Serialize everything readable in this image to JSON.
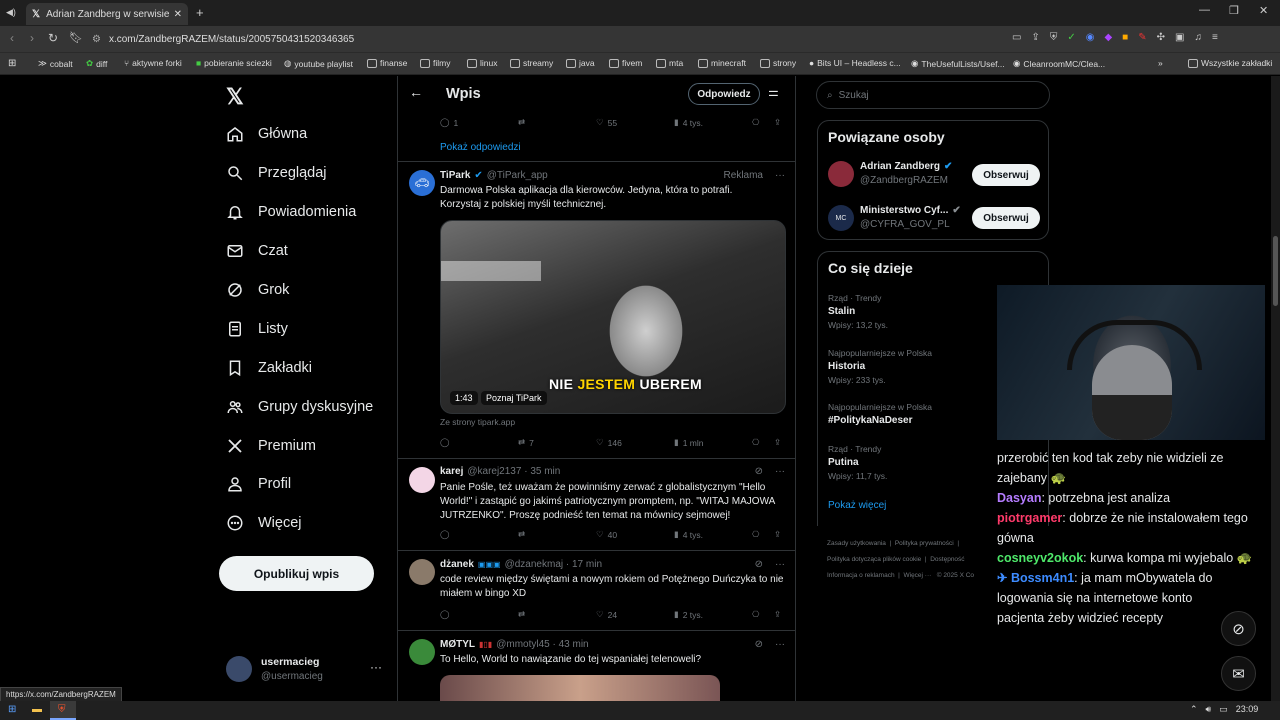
{
  "browser": {
    "tab_title": "Adrian Zandberg w serwisie X: „",
    "url": "x.com/ZandbergRAZEM/status/2005750431520346365",
    "status_url": "https://x.com/ZandbergRAZEM",
    "bookmarks": [
      "cobalt",
      "diff",
      "aktywne forki",
      "pobieranie sciezki",
      "youtube playlist",
      "finanse",
      "filmy",
      "linux",
      "streamy",
      "java",
      "fivem",
      "mta",
      "minecraft",
      "strony",
      "Bits UI – Headless c...",
      "TheUsefulLists/Usef...",
      "CleanroomMC/Clea...",
      "Wszystkie zakładki"
    ]
  },
  "nav": {
    "items": [
      "Główna",
      "Przeglądaj",
      "Powiadomienia",
      "Czat",
      "Grok",
      "Listy",
      "Zakładki",
      "Grupy dyskusyjne",
      "Premium",
      "Profil",
      "Więcej"
    ],
    "post_button": "Opublikuj wpis",
    "user_name": "usermacieg",
    "user_handle": "@usermacieg"
  },
  "feed": {
    "header_title": "Wpis",
    "reply_button": "Odpowiedz",
    "top_stats": {
      "replies": "1",
      "likes": "55",
      "views": "4 tys."
    },
    "show_replies": "Pokaż odpowiedzi",
    "ad": {
      "name": "TiPark",
      "handle": "@TiPark_app",
      "label": "Reklama",
      "text": "Darmowa Polska aplikacja dla kierowców. Jedyna, która to potrafi. Korzystaj z polskiej myśli technicznej.",
      "video_caption_a": "NIE ",
      "video_caption_b": "JESTEM",
      "video_caption_c": " UBEREM",
      "duration": "1:43",
      "video_link": "Poznaj TiPark",
      "source": "Ze strony tipark.app",
      "reposts": "7",
      "likes": "146",
      "views": "1 mln"
    },
    "posts": [
      {
        "name": "karej",
        "handle": "@karej2137 · 35 min",
        "text": "Panie Pośle, też uważam że powinniśmy zerwać z globalistycznym \"Hello World!\" i zastąpić go jakimś patriotycznym promptem, np. \"WITAJ MAJOWA JUTRZENKO\". Proszę podnieść ten temat na mównicy sejmowej!",
        "replies": "",
        "reposts": "",
        "likes": "40",
        "views": "4 tys."
      },
      {
        "name": "dżanek",
        "handle": "@dzanekmaj · 17 min",
        "text": "code review między świętami a nowym rokiem od Potężnego Duńczyka to nie miałem w bingo XD",
        "replies": "",
        "reposts": "",
        "likes": "24",
        "views": "2 tys."
      },
      {
        "name": "MØTYL",
        "handle": "@mmotyl45 · 43 min",
        "text": "To Hello, World to nawiązanie do tej wspaniałej telenoweli?"
      }
    ]
  },
  "right": {
    "search_placeholder": "Szukaj",
    "related_title": "Powiązane osoby",
    "related": [
      {
        "name": "Adrian Zandberg",
        "handle": "@ZandbergRAZEM",
        "button": "Obserwuj"
      },
      {
        "name": "Ministerstwo Cyf...",
        "handle": "@CYFRA_GOV_PL",
        "button": "Obserwuj"
      }
    ],
    "trends_title": "Co się dzieje",
    "trends": [
      {
        "cat": "Rząd · Trendy",
        "name": "Stalin",
        "count": "Wpisy: 13,2 tys."
      },
      {
        "cat": "Najpopularniejsze w Polska",
        "name": "Historia",
        "count": "Wpisy: 233 tys."
      },
      {
        "cat": "Najpopularniejsze w Polska",
        "name": "#PolitykaNaDeser",
        "count": ""
      },
      {
        "cat": "Rząd · Trendy",
        "name": "Putina",
        "count": "Wpisy: 11,7 tys."
      }
    ],
    "show_more": "Pokaż więcej",
    "footer": [
      "Zasady użytkowania",
      "Polityka prywatności",
      "Polityka dotycząca plików cookie",
      "Dostępność",
      "Informacja o reklamach",
      "Więcej ···",
      "© 2025 X Co"
    ]
  },
  "chat": [
    {
      "user": "",
      "color": "#e7e9ea",
      "text": "przerobić ten kod tak zeby nie widzieli ze zajebany 🐢"
    },
    {
      "user": "Dasyan",
      "color": "#b57cff",
      "text": ": potrzebna jest analiza"
    },
    {
      "user": "piotrgamer",
      "color": "#ff3b6b",
      "text": ": dobrze że nie instalowałem tego gówna"
    },
    {
      "user": "cosneyv2okok",
      "color": "#4ee86a",
      "text": ": kurwa kompa mi wyjebalo 🐢"
    },
    {
      "user": "✈ Bossm4n1",
      "color": "#3d8bff",
      "text": ": ja mam mObywatela do logowania się na internetowe konto pacjenta żeby widzieć recepty"
    }
  ],
  "taskbar": {
    "time": "23:09"
  }
}
